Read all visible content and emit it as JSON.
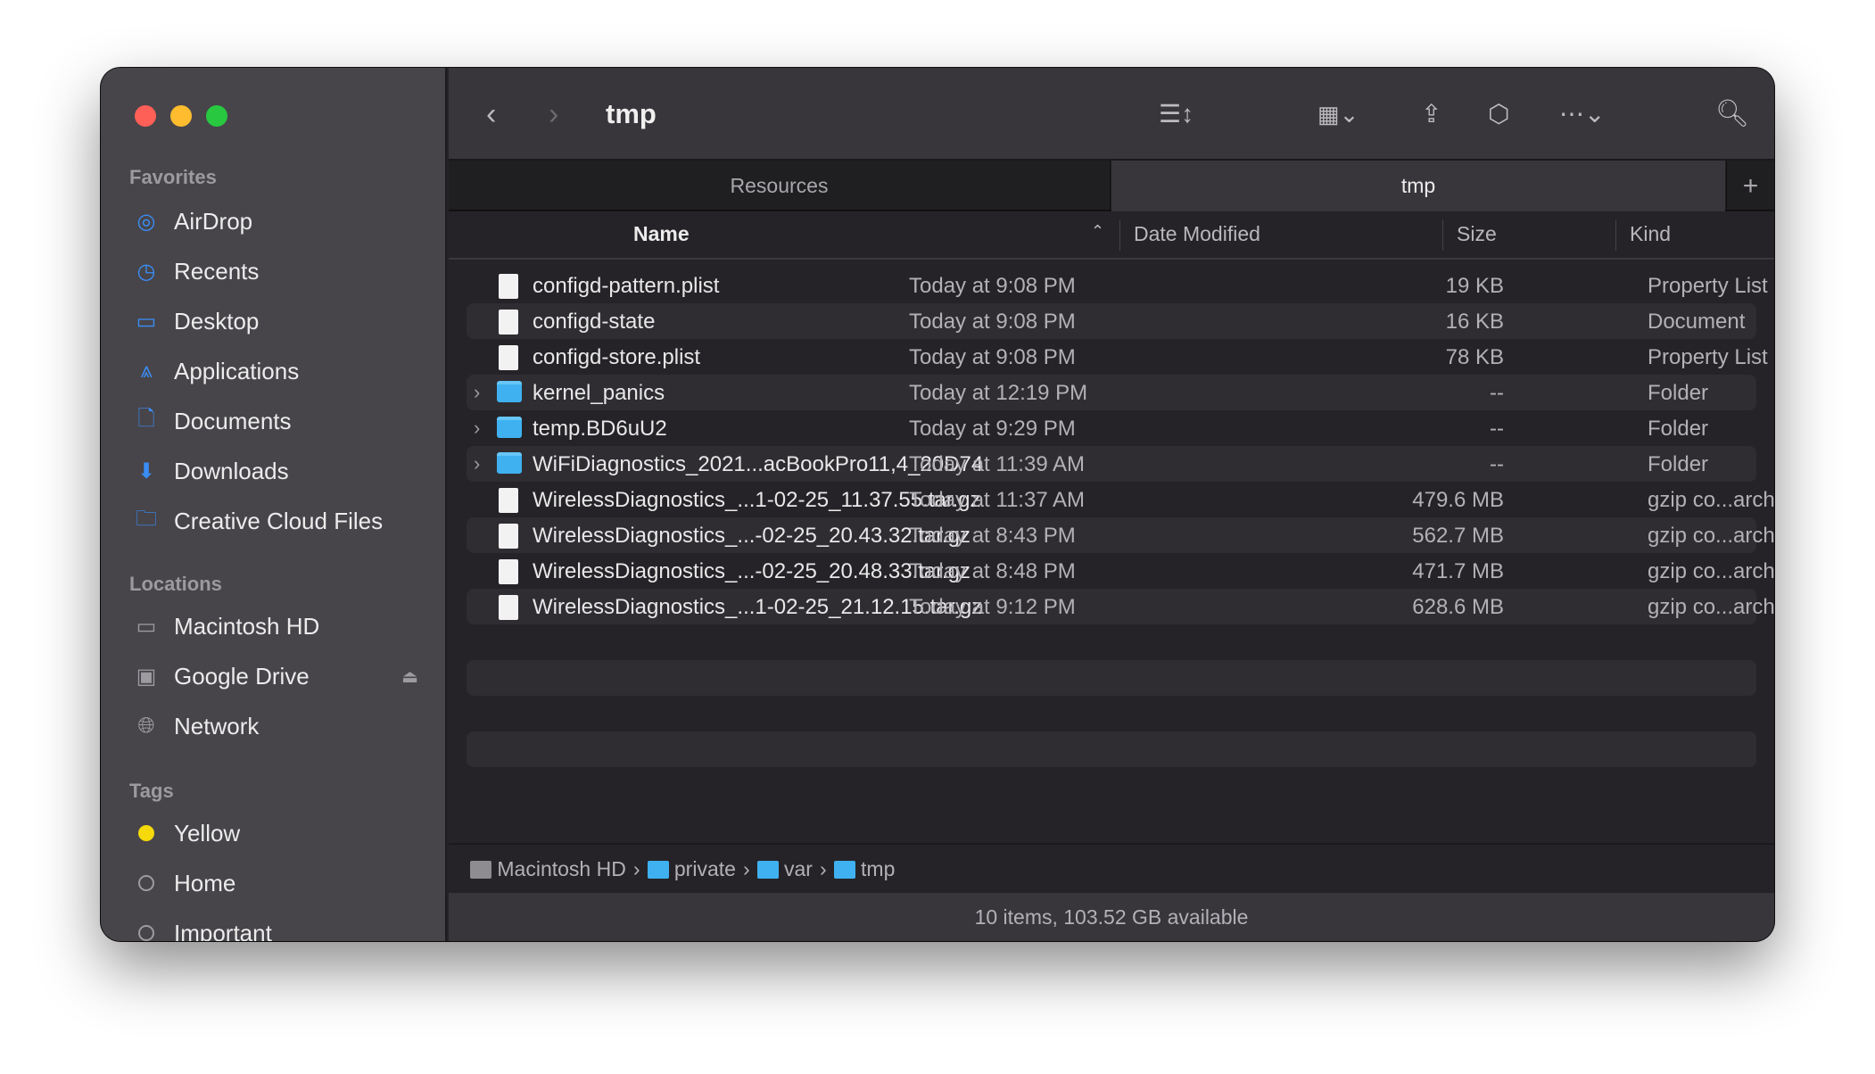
{
  "window": {
    "title": "tmp"
  },
  "sidebar": {
    "favorites_label": "Favorites",
    "favorites": [
      {
        "label": "AirDrop",
        "icon": "airdrop-icon"
      },
      {
        "label": "Recents",
        "icon": "clock-icon"
      },
      {
        "label": "Desktop",
        "icon": "desktop-icon"
      },
      {
        "label": "Applications",
        "icon": "applications-icon"
      },
      {
        "label": "Documents",
        "icon": "document-icon"
      },
      {
        "label": "Downloads",
        "icon": "download-icon"
      },
      {
        "label": "Creative Cloud Files",
        "icon": "folder-icon"
      }
    ],
    "locations_label": "Locations",
    "locations": [
      {
        "label": "Macintosh HD"
      },
      {
        "label": "Google Drive"
      },
      {
        "label": "Network"
      }
    ],
    "tags_label": "Tags",
    "tags": [
      {
        "label": "Yellow",
        "color": "#f5d90a"
      },
      {
        "label": "Home"
      },
      {
        "label": "Important"
      }
    ]
  },
  "tabs": [
    {
      "label": "Resources"
    },
    {
      "label": "tmp",
      "active": true
    }
  ],
  "columns": {
    "name": "Name",
    "date": "Date Modified",
    "size": "Size",
    "kind": "Kind"
  },
  "files": [
    {
      "name": "configd-pattern.plist",
      "date": "Today at 9:08 PM",
      "size": "19 KB",
      "kind": "Property List",
      "type": "file"
    },
    {
      "name": "configd-state",
      "date": "Today at 9:08 PM",
      "size": "16 KB",
      "kind": "Document",
      "type": "file"
    },
    {
      "name": "configd-store.plist",
      "date": "Today at 9:08 PM",
      "size": "78 KB",
      "kind": "Property List",
      "type": "file"
    },
    {
      "name": "kernel_panics",
      "date": "Today at 12:19 PM",
      "size": "--",
      "kind": "Folder",
      "type": "folder"
    },
    {
      "name": "temp.BD6uU2",
      "date": "Today at 9:29 PM",
      "size": "--",
      "kind": "Folder",
      "type": "folder"
    },
    {
      "name": "WiFiDiagnostics_2021...acBookPro11,4_20D74",
      "date": "Today at 11:39 AM",
      "size": "--",
      "kind": "Folder",
      "type": "folder"
    },
    {
      "name": "WirelessDiagnostics_...1-02-25_11.37.55.tar.gz",
      "date": "Today at 11:37 AM",
      "size": "479.6 MB",
      "kind": "gzip co...archive",
      "type": "file"
    },
    {
      "name": "WirelessDiagnostics_...-02-25_20.43.32.tar.gz",
      "date": "Today at 8:43 PM",
      "size": "562.7 MB",
      "kind": "gzip co...archive",
      "type": "file"
    },
    {
      "name": "WirelessDiagnostics_...-02-25_20.48.33.tar.gz",
      "date": "Today at 8:48 PM",
      "size": "471.7 MB",
      "kind": "gzip co...archive",
      "type": "file"
    },
    {
      "name": "WirelessDiagnostics_...1-02-25_21.12.15.tar.gz",
      "date": "Today at 9:12 PM",
      "size": "628.6 MB",
      "kind": "gzip co...archive",
      "type": "file"
    }
  ],
  "path": [
    "Macintosh HD",
    "private",
    "var",
    "tmp"
  ],
  "status": "10 items, 103.52 GB available"
}
